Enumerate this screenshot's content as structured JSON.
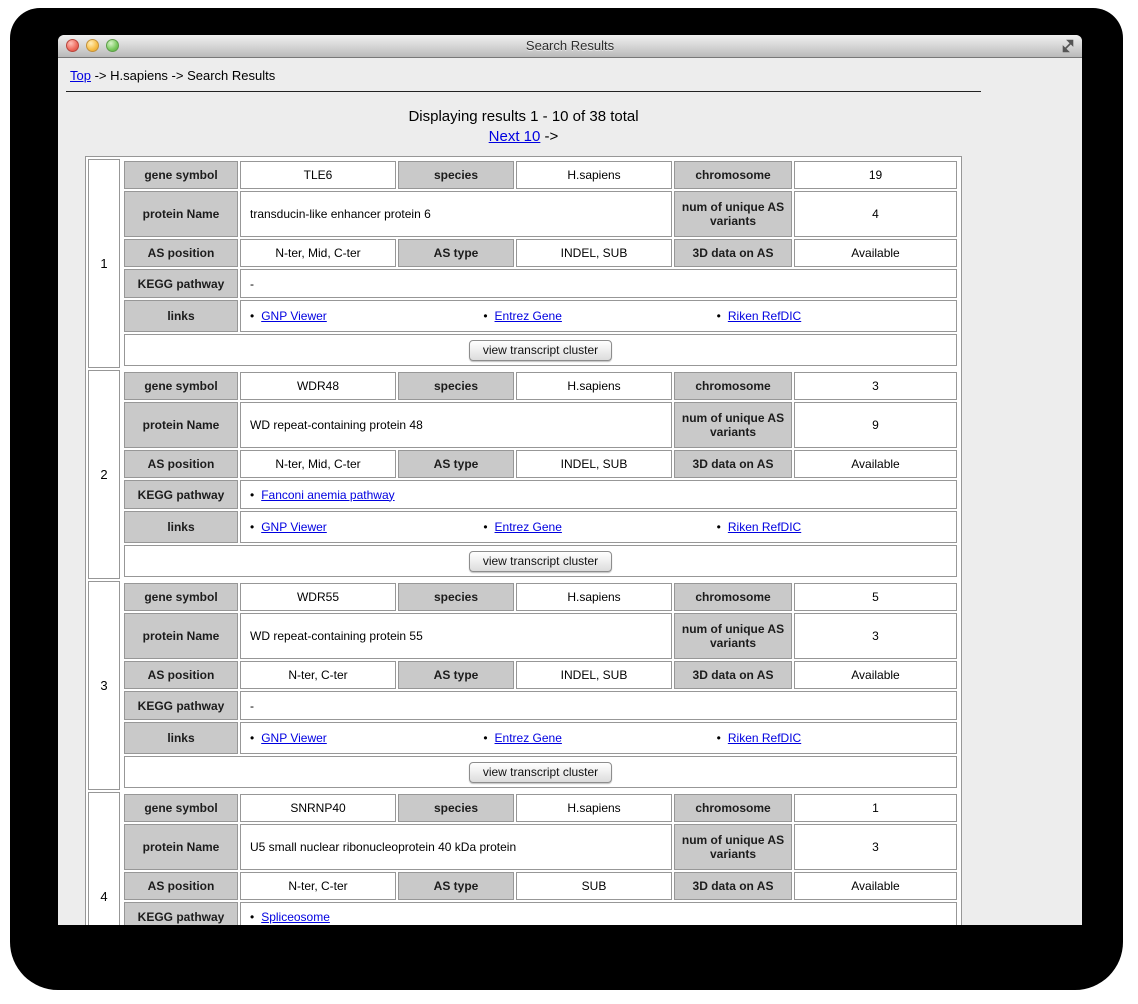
{
  "window": {
    "title": "Search Results"
  },
  "breadcrumb": {
    "top_link": "Top",
    "trail": " -> H.sapiens -> Search Results"
  },
  "results_header": {
    "summary": "Displaying results 1 - 10 of 38 total",
    "next_link": "Next 10",
    "next_suffix": " ->"
  },
  "labels": {
    "gene_symbol": "gene symbol",
    "species": "species",
    "chromosome": "chromosome",
    "protein_name": "protein Name",
    "num_variants": "num of unique AS variants",
    "as_position": "AS position",
    "as_type": "AS type",
    "data_3d": "3D data on AS",
    "kegg": "KEGG pathway",
    "links": "links",
    "link_items": [
      "GNP Viewer",
      "Entrez Gene",
      "Riken RefDIC"
    ],
    "view_button": "view transcript cluster"
  },
  "colors": {
    "link_blue": "#0000e0",
    "header_cell_gray": "#c9c9c9",
    "cell_border_gray": "#979797",
    "page_background": "#ededed"
  },
  "entries": [
    {
      "num": "1",
      "gene_symbol": "TLE6",
      "species": "H.sapiens",
      "chromosome": "19",
      "protein_name": "transducin-like enhancer protein 6",
      "num_variants": "4",
      "as_position": "N-ter, Mid, C-ter",
      "as_type": "INDEL, SUB",
      "data_3d": "Available",
      "kegg_text": "-"
    },
    {
      "num": "2",
      "gene_symbol": "WDR48",
      "species": "H.sapiens",
      "chromosome": "3",
      "protein_name": "WD repeat-containing protein 48",
      "num_variants": "9",
      "as_position": "N-ter, Mid, C-ter",
      "as_type": "INDEL, SUB",
      "data_3d": "Available",
      "kegg_link": "Fanconi anemia pathway"
    },
    {
      "num": "3",
      "gene_symbol": "WDR55",
      "species": "H.sapiens",
      "chromosome": "5",
      "protein_name": "WD repeat-containing protein 55",
      "num_variants": "3",
      "as_position": "N-ter, C-ter",
      "as_type": "INDEL, SUB",
      "data_3d": "Available",
      "kegg_text": "-"
    },
    {
      "num": "4",
      "gene_symbol": "SNRNP40",
      "species": "H.sapiens",
      "chromosome": "1",
      "protein_name": "U5 small nuclear ribonucleoprotein 40 kDa protein",
      "num_variants": "3",
      "as_position": "N-ter, C-ter",
      "as_type": "SUB",
      "data_3d": "Available",
      "kegg_link": "Spliceosome"
    }
  ]
}
